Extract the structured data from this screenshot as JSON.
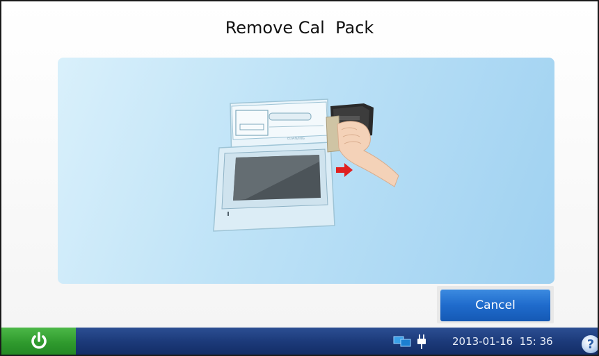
{
  "screen": {
    "title": "Remove Cal  Pack"
  },
  "illustration": {
    "description_icon": "device-cal-pack-removal-illustration",
    "device_logo": "EDAN/ING"
  },
  "actions": {
    "cancel_label": "Cancel"
  },
  "taskbar": {
    "power_icon": "power-icon",
    "network_icon": "network-icon",
    "plug_icon": "power-plug-icon",
    "datetime": "2013-01-16  15: 36",
    "help_icon": "help-icon"
  },
  "colors": {
    "accent_blue": "#1f6bcc",
    "power_green": "#2f9a2d",
    "taskbar_blue": "#1c3a7a",
    "arrow_red": "#e02020"
  }
}
